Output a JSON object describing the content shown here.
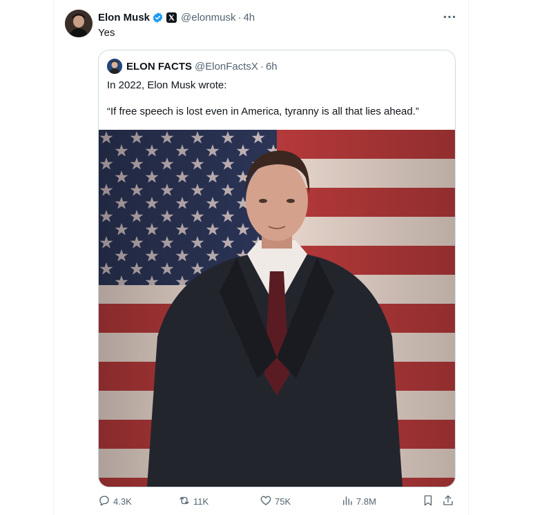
{
  "tweet": {
    "author_name": "Elon Musk",
    "handle": "@elonmusk",
    "separator": "·",
    "time": "4h",
    "text": "Yes"
  },
  "quote": {
    "author_name": "ELON FACTS",
    "handle": "@ElonFactsX",
    "separator": "·",
    "time": "6h",
    "line1": "In 2022, Elon Musk wrote:",
    "line2": "“If free speech is lost even in America, tyranny is all that lies ahead.”"
  },
  "actions": {
    "replies": "4.3K",
    "reposts": "11K",
    "likes": "75K",
    "views": "7.8M"
  },
  "icons": {
    "verified": "verified-badge-icon",
    "affiliate": "x-logo-icon",
    "more": "more-icon",
    "reply": "reply-icon",
    "repost": "repost-icon",
    "like": "heart-icon",
    "views": "views-icon",
    "bookmark": "bookmark-icon",
    "share": "share-icon"
  },
  "colors": {
    "text_primary": "#0f1419",
    "text_secondary": "#536471",
    "verified_blue": "#1d9bf0",
    "border": "#cfd9de"
  }
}
